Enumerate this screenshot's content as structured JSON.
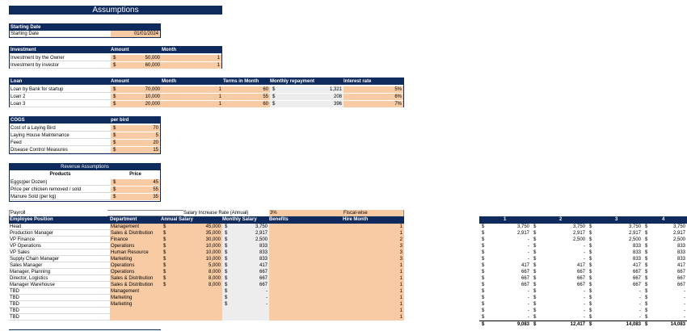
{
  "title": "Assumptions",
  "starting_date": {
    "header": "Starting Date",
    "label": "Starting Date",
    "value": "01/01/2024"
  },
  "investment": {
    "headers": [
      "Investment",
      "Amount",
      "Month"
    ],
    "rows": [
      {
        "label": "Investment by the Owner",
        "amount": "50,000",
        "month": "1"
      },
      {
        "label": "Investment by investor",
        "amount": "60,000",
        "month": "1"
      }
    ]
  },
  "loan": {
    "headers": [
      "Loan",
      "Amount",
      "Month",
      "Terms in Month",
      "Monthly repayment",
      "Interest rate"
    ],
    "rows": [
      {
        "label": "Loan by Bank for startup",
        "amount": "70,000",
        "month": "1",
        "terms": "60",
        "repayment": "1,321",
        "rate": "5%"
      },
      {
        "label": "Loan 2",
        "amount": "10,000",
        "month": "1",
        "terms": "55",
        "repayment": "208",
        "rate": "6%"
      },
      {
        "label": "Loan 3",
        "amount": "20,000",
        "month": "1",
        "terms": "60",
        "repayment": "396",
        "rate": "7%"
      }
    ]
  },
  "cogs": {
    "headers": [
      "COGS",
      "per bird"
    ],
    "rows": [
      {
        "label": "Cost of a Laying Bird",
        "value": "70"
      },
      {
        "label": "Laying House Maintenance",
        "value": "5"
      },
      {
        "label": "Feed",
        "value": "20"
      },
      {
        "label": "Disease Control Measures",
        "value": "15"
      }
    ]
  },
  "revenue": {
    "title": "Revenue Assumptions",
    "headers": [
      "Products",
      "Price"
    ],
    "rows": [
      {
        "label": "Eggs(per Dozen)",
        "value": "45"
      },
      {
        "label": "Price per chicken removed / sold",
        "value": "55"
      },
      {
        "label": "Manure Sold (per kg)",
        "value": "35"
      }
    ]
  },
  "payroll": {
    "label": "Payroll",
    "increase_label": "Salary Increase Rate (Annual)",
    "increase_value": "3%",
    "fiscal": "Fiscal-wise",
    "headers": [
      "Employee Position",
      "Department",
      "Annual Salary",
      "Monthly Salary",
      "Benefits",
      "Hire Month"
    ],
    "rows": [
      {
        "pos": "Head",
        "dept": "Management",
        "annual": "45,000",
        "monthly": "3,750",
        "hire": "1"
      },
      {
        "pos": "Production Manager",
        "dept": "Sales & Distribution",
        "annual": "35,000",
        "monthly": "2,917",
        "hire": "1"
      },
      {
        "pos": "VP Finance",
        "dept": "Finance",
        "annual": "30,000",
        "monthly": "2,500",
        "hire": "2"
      },
      {
        "pos": "VP Operations",
        "dept": "Operations",
        "annual": "10,000",
        "monthly": "833",
        "hire": "3"
      },
      {
        "pos": "VP Sales",
        "dept": "Human Resource",
        "annual": "10,000",
        "monthly": "833",
        "hire": "3"
      },
      {
        "pos": "Supply Chain Manager",
        "dept": "Marketing",
        "annual": "10,000",
        "monthly": "833",
        "hire": "3"
      },
      {
        "pos": "Sales Manager",
        "dept": "Operations",
        "annual": "5,000",
        "monthly": "417",
        "hire": "1"
      },
      {
        "pos": "Manager, Planning",
        "dept": "Operations",
        "annual": "8,000",
        "monthly": "667",
        "hire": "1"
      },
      {
        "pos": "Director, Logistics",
        "dept": "Sales & Distribution",
        "annual": "8,000",
        "monthly": "667",
        "hire": "1"
      },
      {
        "pos": "Manager Warehouse",
        "dept": "Sales & Distribution",
        "annual": "8,000",
        "monthly": "667",
        "hire": "1"
      },
      {
        "pos": "TBD",
        "dept": "Management",
        "annual": "",
        "monthly": "-",
        "hire": "1"
      },
      {
        "pos": "TBD",
        "dept": "Marketing",
        "annual": "",
        "monthly": "-",
        "hire": "1"
      },
      {
        "pos": "TBD",
        "dept": "Marketing",
        "annual": "",
        "monthly": "-",
        "hire": "1"
      },
      {
        "pos": "TBD",
        "dept": "",
        "annual": "",
        "monthly": "",
        "hire": "1"
      },
      {
        "pos": "TBD",
        "dept": "",
        "annual": "",
        "monthly": "",
        "hire": "1"
      }
    ]
  },
  "monthly": {
    "headers": [
      "1",
      "2",
      "3",
      "4"
    ],
    "rows": [
      [
        "3,750",
        "3,750",
        "3,750",
        "3,750"
      ],
      [
        "2,917",
        "2,917",
        "2,917",
        "2,917"
      ],
      [
        "-",
        "2,500",
        "2,500",
        "2,500"
      ],
      [
        "-",
        "-",
        "833",
        "833"
      ],
      [
        "-",
        "-",
        "833",
        "833"
      ],
      [
        "-",
        "-",
        "833",
        "833"
      ],
      [
        "417",
        "417",
        "417",
        "417"
      ],
      [
        "667",
        "667",
        "667",
        "667"
      ],
      [
        "667",
        "667",
        "667",
        "667"
      ],
      [
        "667",
        "667",
        "667",
        "667"
      ],
      [
        "-",
        "-",
        "-",
        "-"
      ],
      [
        "-",
        "-",
        "-",
        "-"
      ],
      [
        "-",
        "-",
        "-",
        "-"
      ],
      [
        "-",
        "-",
        "-",
        "-"
      ],
      [
        "-",
        "-",
        "-",
        "-"
      ]
    ],
    "totals": [
      "9,083",
      "12,417",
      "14,083",
      "14,083"
    ]
  },
  "currency": "$",
  "colors": {
    "header": "#0f2a5c",
    "input": "#f8cba5",
    "calc": "#ededed"
  }
}
